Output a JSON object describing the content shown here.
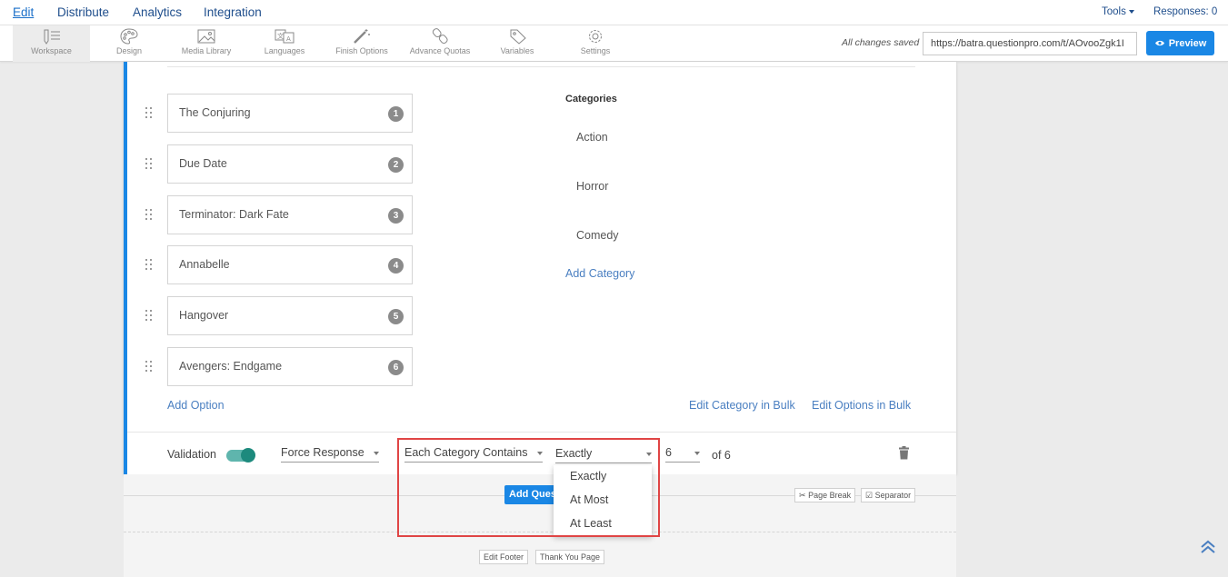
{
  "topnav": {
    "edit": "Edit",
    "distribute": "Distribute",
    "analytics": "Analytics",
    "integration": "Integration",
    "tools": "Tools",
    "responses": "Responses: 0"
  },
  "toolbar": {
    "workspace": "Workspace",
    "design": "Design",
    "media_library": "Media Library",
    "languages": "Languages",
    "finish_options": "Finish Options",
    "advance_quotas": "Advance Quotas",
    "variables": "Variables",
    "settings": "Settings",
    "saved_status": "All changes saved",
    "url": "https://batra.questionpro.com/t/AOvooZgk1I",
    "preview": "Preview"
  },
  "question": {
    "options": [
      {
        "label": "The Conjuring",
        "number": "1"
      },
      {
        "label": "Due Date",
        "number": "2"
      },
      {
        "label": "Terminator: Dark Fate",
        "number": "3"
      },
      {
        "label": "Annabelle",
        "number": "4"
      },
      {
        "label": "Hangover",
        "number": "5"
      },
      {
        "label": "Avengers: Endgame",
        "number": "6"
      }
    ],
    "categories_title": "Categories",
    "categories": [
      "Action",
      "Horror",
      "Comedy"
    ],
    "add_category": "Add Category",
    "add_option": "Add Option",
    "edit_category_bulk": "Edit Category in Bulk",
    "edit_options_bulk": "Edit Options in Bulk"
  },
  "validation": {
    "label": "Validation",
    "enabled": true,
    "force_response": "Force Response",
    "each_category": "Each Category Contains",
    "comparison": "Exactly",
    "count": "6",
    "of_total": "of 6",
    "menu_options": [
      "Exactly",
      "At Most",
      "At Least"
    ]
  },
  "footer": {
    "add_question": "Add Question",
    "page_break": "Page Break",
    "separator": "Separator",
    "edit_footer": "Edit Footer",
    "thank_you_page": "Thank You Page"
  },
  "colors": {
    "accent": "#1a87e5",
    "toggle": "#1d8a7d",
    "highlight": "#e04545"
  }
}
